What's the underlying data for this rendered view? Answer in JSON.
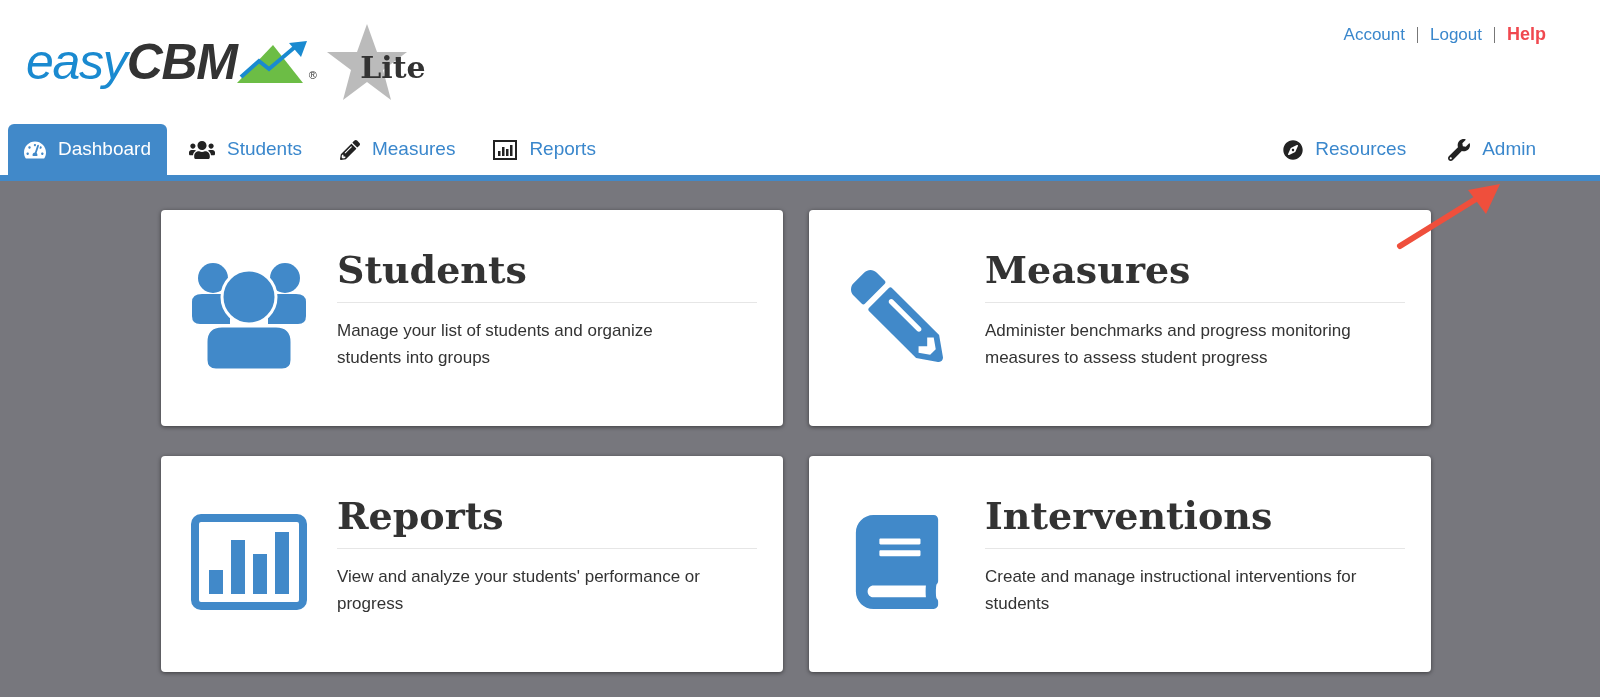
{
  "logo": {
    "brand_light": "easy",
    "brand_bold": "CBM",
    "registered_mark": "®",
    "edition": "Lite"
  },
  "top_links": [
    {
      "label": "Account",
      "kind": "link"
    },
    {
      "label": "Logout",
      "kind": "link"
    },
    {
      "label": "Help",
      "kind": "help"
    }
  ],
  "nav": {
    "left_tabs": [
      {
        "label": "Dashboard",
        "kind": "gauge",
        "selected": true
      },
      {
        "label": "Students",
        "kind": "users",
        "selected": false
      },
      {
        "label": "Measures",
        "kind": "pencil",
        "selected": false
      },
      {
        "label": "Reports",
        "kind": "chart",
        "selected": false
      }
    ],
    "right_tabs": [
      {
        "label": "Resources",
        "kind": "compass",
        "selected": false
      },
      {
        "label": "Admin",
        "kind": "wrench",
        "selected": false
      }
    ]
  },
  "cards": [
    {
      "title": "Students",
      "kind": "users",
      "description": "Manage your list of students and organize students into groups"
    },
    {
      "title": "Measures",
      "kind": "pencil",
      "description": "Administer benchmarks and progress monitoring measures to assess student progress"
    },
    {
      "title": "Reports",
      "kind": "chart",
      "description": "View and analyze your students' performance or progress"
    },
    {
      "title": "Interventions",
      "kind": "book",
      "description": "Create and manage instructional interventions for students"
    }
  ]
}
